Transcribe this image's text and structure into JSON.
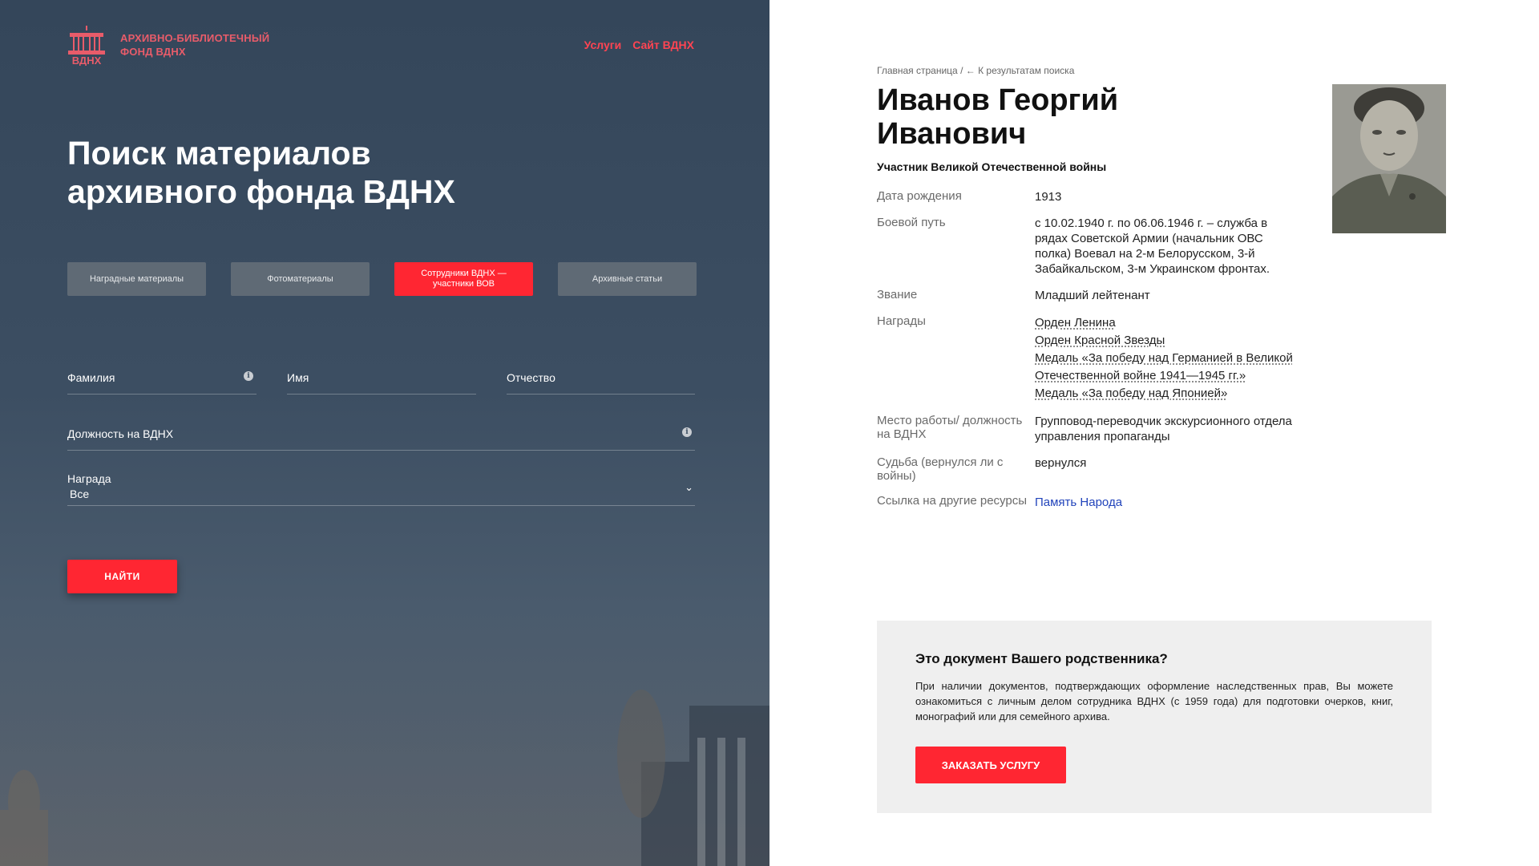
{
  "header": {
    "logo_line1": "АРХИВНО-БИБЛИОТЕЧНЫЙ",
    "logo_line2": "ФОНД ВДНХ",
    "logo_mark_text": "ВДНХ",
    "nav": [
      {
        "label": "Услуги"
      },
      {
        "label": "Сайт ВДНХ"
      }
    ]
  },
  "search": {
    "title_line1": "Поиск материалов",
    "title_line2": "архивного фонда ВДНХ",
    "tabs": [
      {
        "label": "Наградные материалы",
        "active": false
      },
      {
        "label": "Фотоматериалы",
        "active": false
      },
      {
        "label": "Сотрудники ВДНХ — участники ВОВ",
        "active": true
      },
      {
        "label": "Архивные статьи",
        "active": false
      }
    ],
    "fields": {
      "surname": "Фамилия",
      "name": "Имя",
      "patronymic": "Отчество",
      "position": "Должность на ВДНХ",
      "award_label": "Награда",
      "award_value": "Все"
    },
    "find_button": "НАЙТИ"
  },
  "person": {
    "breadcrumb_home": "Главная страница",
    "breadcrumb_back": "← К результатам поиска",
    "name_line1": "Иванов Георгий",
    "name_line2": "Иванович",
    "subtitle": "Участник Великой Отечественной войны",
    "birth_label": "Дата рождения",
    "birth_value": "1913",
    "service_label": "Боевой путь",
    "service_value": "с 10.02.1940 г. по 06.06.1946 г. – служба в рядах Советской Армии (начальник ОВС полка) Воевал на 2-м Белорусском, 3-й Забайкальском, 3-м Украинском фронтах.",
    "rank_label": "Звание",
    "rank_value": "Младший лейтенант",
    "awards_label": "Награды",
    "awards": [
      "Орден Ленина",
      "Орден Красной Звезды",
      "Медаль «За победу над Германией в Великой Отечественной войне 1941—1945 гг.»",
      "Медаль «За победу над Японией»"
    ],
    "work_label": "Место работы/ должность на ВДНХ",
    "work_value": "Групповод-переводчик экскурсионного отдела управления пропаганды",
    "fate_label": "Судьба (вернулся ли с войны)",
    "fate_value": "вернулся",
    "link_label": "Ссылка на другие ресурсы",
    "link_value": "Память Народа"
  },
  "relative_card": {
    "title": "Это документ Вашего родственника?",
    "text": "При наличии документов, подтверждающих оформление наследственных прав, Вы можете ознакомиться с личным делом сотрудника ВДНХ (с 1959 года) для подготовки очерков, книг, монографий или для семейного архива.",
    "button": "ЗАКАЗАТЬ УСЛУГУ"
  },
  "colors": {
    "accent": "#ff2632",
    "logo": "#e85c6a",
    "panel_bg": "#3c4e62",
    "tab_bg": "#5f6a75",
    "card_bg": "#efefef",
    "link_blue": "#2244bb"
  },
  "icons": [
    "vdnh-logo-icon",
    "info-icon",
    "chevron-down-icon"
  ]
}
